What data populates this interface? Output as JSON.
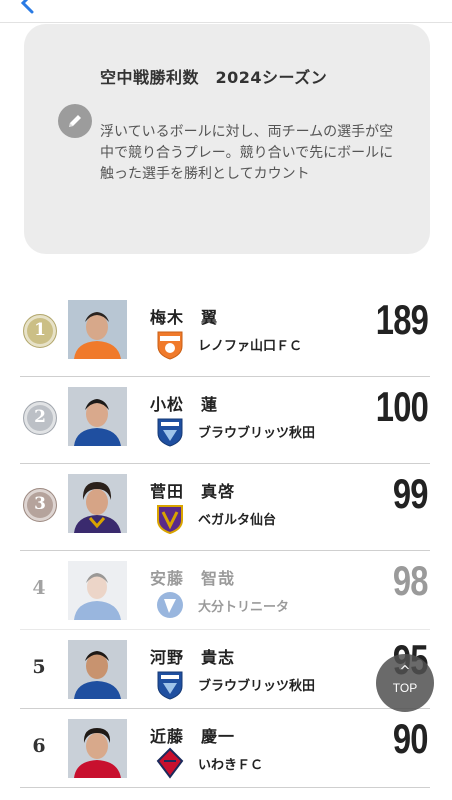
{
  "header": {
    "back_icon": "chevron-left-icon"
  },
  "info_card": {
    "title": "空中戦勝利数　2024シーズン",
    "icon": "pencil-icon",
    "description": "浮いているボールに対し、両チームの選手が空中で競り合うプレー。競り合いで先にボールに触った選手を勝利としてカウント"
  },
  "rankings": [
    {
      "rank": "1",
      "name": "梅木　翼",
      "team": "レノファ山口ＦＣ",
      "value": "189",
      "medal": "gold",
      "team_color": "#f07a2b"
    },
    {
      "rank": "2",
      "name": "小松　蓮",
      "team": "ブラウブリッツ秋田",
      "value": "100",
      "medal": "silver",
      "team_color": "#1f4fa0"
    },
    {
      "rank": "3",
      "name": "菅田　真啓",
      "team": "ベガルタ仙台",
      "value": "99",
      "medal": "bronze",
      "team_color": "#d9a400"
    },
    {
      "rank": "4",
      "name": "安藤　智哉",
      "team": "大分トリニータ",
      "value": "98",
      "medal": "none",
      "team_color": "#1e5fb8"
    },
    {
      "rank": "5",
      "name": "河野　貴志",
      "team": "ブラウブリッツ秋田",
      "value": "95",
      "medal": "none",
      "team_color": "#1f4fa0"
    },
    {
      "rank": "6",
      "name": "近藤　慶一",
      "team": "いわきＦＣ",
      "value": "90",
      "medal": "none",
      "team_color": "#c8102e"
    }
  ],
  "scroll_top": {
    "caret": "^",
    "label": "TOP"
  }
}
